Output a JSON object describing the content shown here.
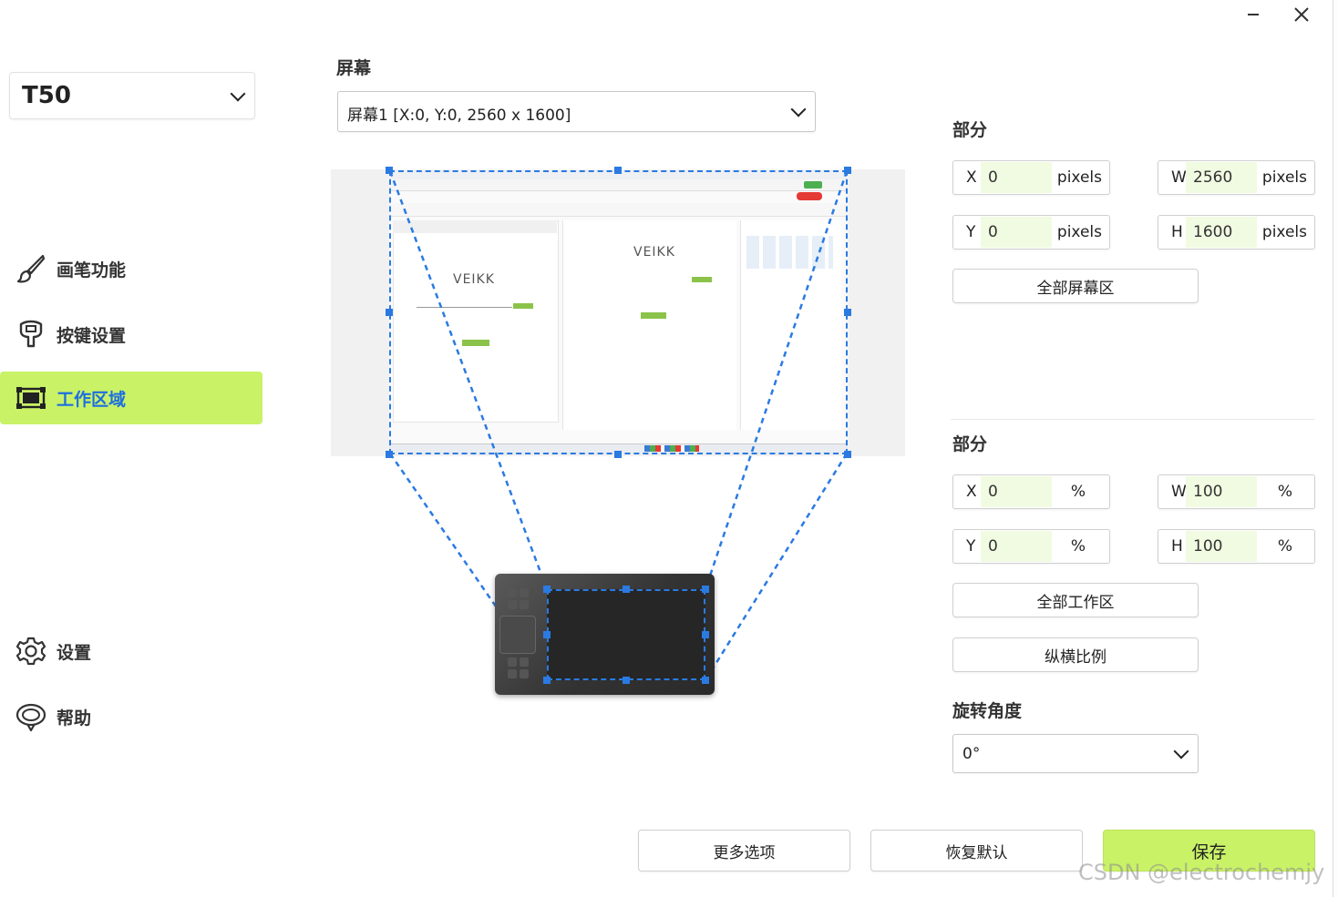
{
  "window": {
    "minimize_label": "−",
    "close_label": "✕"
  },
  "device": {
    "name": "T50"
  },
  "sidebar": {
    "items": [
      {
        "label": "画笔功能",
        "icon": "brush-icon",
        "active": false
      },
      {
        "label": "按键设置",
        "icon": "key-icon",
        "active": false
      },
      {
        "label": "工作区域",
        "icon": "work-area-icon",
        "active": true
      }
    ],
    "bottom_items": [
      {
        "label": "设置",
        "icon": "gear-icon"
      },
      {
        "label": "帮助",
        "icon": "help-icon"
      }
    ]
  },
  "screen": {
    "label": "屏幕",
    "selected": "屏幕1 [X:0, Y:0,  2560 x 1600]"
  },
  "preview": {
    "brand_text": "VEIKK"
  },
  "screen_area": {
    "label": "部分",
    "x": {
      "letter": "X",
      "value": "0",
      "unit": "pixels"
    },
    "y": {
      "letter": "Y",
      "value": "0",
      "unit": "pixels"
    },
    "w": {
      "letter": "W",
      "value": "2560",
      "unit": "pixels"
    },
    "h": {
      "letter": "H",
      "value": "1600",
      "unit": "pixels"
    },
    "full_button": "全部屏幕区"
  },
  "tablet_area": {
    "label": "部分",
    "x": {
      "letter": "X",
      "value": "0",
      "unit": "%"
    },
    "y": {
      "letter": "Y",
      "value": "0",
      "unit": "%"
    },
    "w": {
      "letter": "W",
      "value": "100",
      "unit": "%"
    },
    "h": {
      "letter": "H",
      "value": "100",
      "unit": "%"
    },
    "full_button": "全部工作区",
    "ratio_button": "纵横比例"
  },
  "rotation": {
    "label": "旋转角度",
    "selected": "0°"
  },
  "footer": {
    "more_button": "更多选项",
    "reset_button": "恢复默认",
    "save_button": "保存"
  },
  "watermark": "CSDN @electrochemjy",
  "colors": {
    "accent": "#c9f267",
    "selection": "#2a7ae2",
    "active_text": "#1d6fe0"
  }
}
